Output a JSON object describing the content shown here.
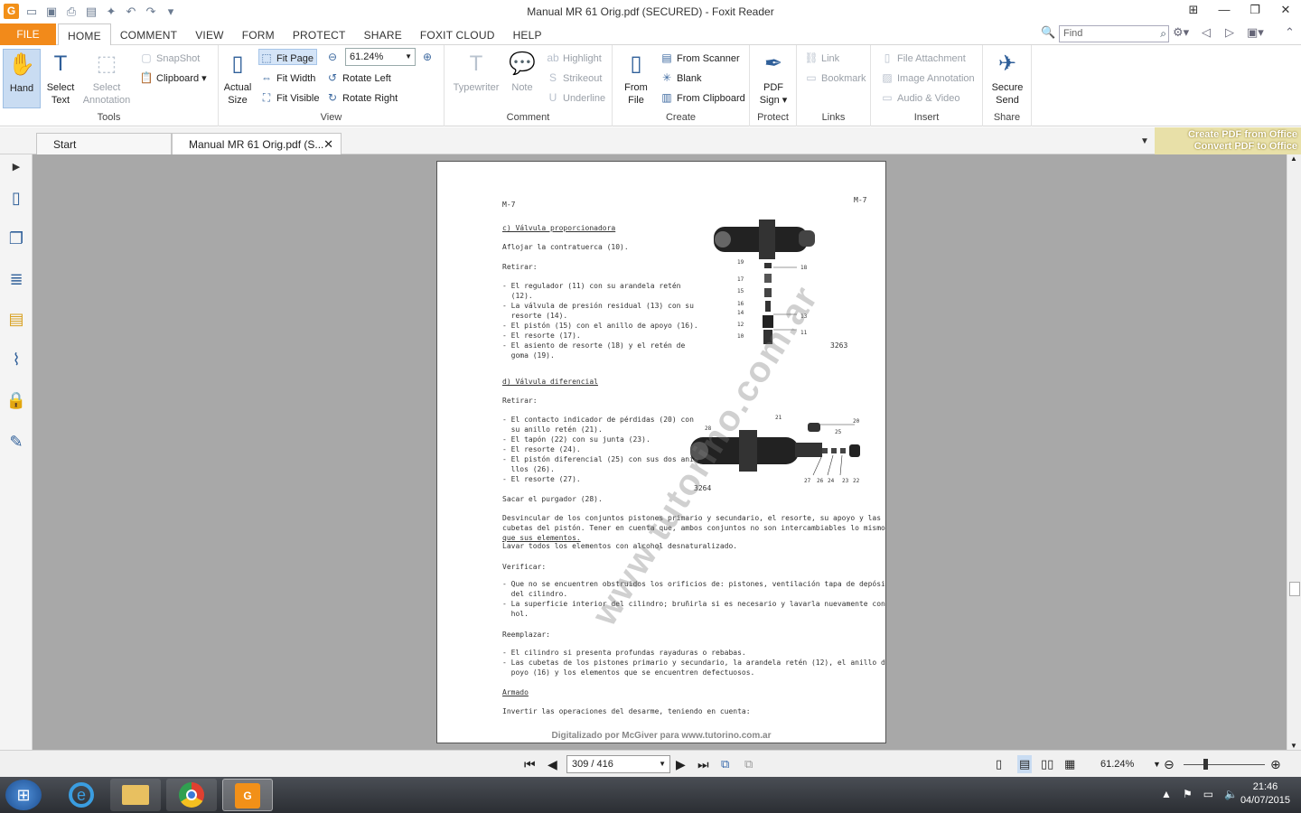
{
  "window": {
    "title": "Manual MR 61 Orig.pdf (SECURED) - Foxit Reader"
  },
  "ribbon_tabs": [
    "FILE",
    "HOME",
    "COMMENT",
    "VIEW",
    "FORM",
    "PROTECT",
    "SHARE",
    "FOXIT CLOUD",
    "HELP"
  ],
  "search": {
    "placeholder": "Find"
  },
  "tools": {
    "hand": "Hand",
    "select_text_1": "Select",
    "select_text_2": "Text",
    "select_annot_1": "Select",
    "select_annot_2": "Annotation",
    "snapshot": "SnapShot",
    "clipboard": "Clipboard",
    "group": "Tools"
  },
  "view": {
    "actual_1": "Actual",
    "actual_2": "Size",
    "fit_page": "Fit Page",
    "fit_width": "Fit Width",
    "fit_visible": "Fit Visible",
    "zoom": "61.24%",
    "rotate_left": "Rotate Left",
    "rotate_right": "Rotate Right",
    "group": "View"
  },
  "comment": {
    "typewriter": "Typewriter",
    "note": "Note",
    "highlight": "Highlight",
    "strikeout": "Strikeout",
    "underline": "Underline",
    "group": "Comment"
  },
  "create": {
    "from_file_1": "From",
    "from_file_2": "File",
    "from_scanner": "From Scanner",
    "blank": "Blank",
    "from_clipboard": "From Clipboard",
    "group": "Create"
  },
  "protect": {
    "pdf_sign_1": "PDF",
    "pdf_sign_2": "Sign",
    "group": "Protect"
  },
  "links": {
    "link": "Link",
    "bookmark": "Bookmark",
    "group": "Links"
  },
  "insert": {
    "file_attachment": "File Attachment",
    "image_annotation": "Image Annotation",
    "audio_video": "Audio & Video",
    "group": "Insert"
  },
  "share": {
    "secure_send_1": "Secure",
    "secure_send_2": "Send",
    "group": "Share"
  },
  "doc_tabs": {
    "start": "Start",
    "current": "Manual MR 61 Orig.pdf (S..."
  },
  "promo": {
    "line1": "Create PDF from Office",
    "line2": "Convert PDF to Office"
  },
  "page": {
    "header_left": "M-7",
    "header_right": "M-7",
    "sec_c": "c) Válvula proporcionadora",
    "c1": "Aflojar la contratuerca (10).",
    "retirar": "Retirar:",
    "c_items": [
      "- El regulador (11) con su arandela retén",
      "  (12).",
      "- La válvula de presión residual (13) con su",
      "  resorte (14).",
      "- El pistón (15) con el anillo de apoyo (16).",
      "- El resorte (17).",
      "- El asiento de resorte (18) y el retén de",
      "  goma (19)."
    ],
    "fig1_num": "3263",
    "fig1_labels": [
      "19",
      "18",
      "17",
      "15",
      "16",
      "14",
      "13",
      "12",
      "11",
      "10"
    ],
    "sec_d": "d) Válvula diferencial",
    "retirar2": "Retirar:",
    "d_items": [
      "- El contacto indicador de pérdidas (20) con",
      "  su anillo retén (21).",
      "- El tapón (22) con su junta (23).",
      "- El resorte (24).",
      "- El pistón diferencial (25) con sus dos ani-",
      "  llos (26).",
      "- El resorte (27)."
    ],
    "fig2_num": "3264",
    "fig2_labels": [
      "21",
      "20",
      "28",
      "25",
      "27",
      "26",
      "24",
      "23",
      "22"
    ],
    "sacar": "Sacar el purgador (28).",
    "desv1": "Desvincular de los conjuntos pistones primario y secundario, el resorte, su apoyo y las dos",
    "desv2": "cubetas del pistón. Tener en cuenta que, ambos conjuntos no son intercambiables lo mismo",
    "desv3": "que sus elementos.",
    "lavar": "Lavar todos los elementos con alcohol desnaturalizado.",
    "verificar": "Verificar:",
    "v_items": [
      "- Que no se encuentren obstruidos los orificios de: pistones, ventilación tapa de depósito y",
      "  del cilindro.",
      "- La superficie interior del cilindro; bruñirla si es necesario y lavarla nuevamente con alco-",
      "  hol."
    ],
    "reemplazar": "Reemplazar:",
    "r_items": [
      "- El cilindro si presenta profundas rayaduras o rebabas.",
      "- Las cubetas de los pistones primario y secundario, la arandela retén (12), el anillo de a-",
      "  poyo (16) y los elementos que se encuentren defectuosos."
    ],
    "armado": "Armado",
    "invertir": "Invertir las operaciones del desarme, teniendo en cuenta:",
    "watermark": "www.tutorino.com.ar",
    "footer": "Digitalizado por McGiver para www.tutorino.com.ar"
  },
  "nav": {
    "page": "309 / 416",
    "zoom": "61.24%"
  },
  "clock": {
    "time": "21:46",
    "date": "04/07/2015"
  }
}
